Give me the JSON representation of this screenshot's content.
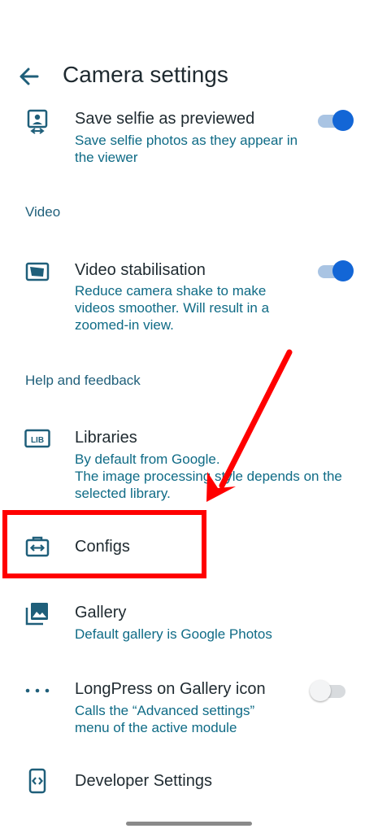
{
  "appbar": {
    "title": "Camera settings"
  },
  "items": {
    "selfie": {
      "title": "Save selfie as previewed",
      "subtitle": "Save selfie photos as they appear in the viewer",
      "icon": "selfie-icon",
      "toggle": true
    },
    "video_section": "Video",
    "stabilisation": {
      "title": "Video stabilisation",
      "subtitle": "Reduce camera shake to make videos smoother. Will result in a zoomed-in view.",
      "icon": "video-stabilisation-icon",
      "toggle": true
    },
    "help_section": "Help and feedback",
    "libraries": {
      "title": "Libraries",
      "subtitle_line1": "By default from Google.",
      "subtitle_line2": "The image processing style depends on the selected library.",
      "icon": "lib-icon",
      "icon_text": "LIB"
    },
    "configs": {
      "title": "Configs",
      "icon": "configs-icon"
    },
    "gallery": {
      "title": "Gallery",
      "subtitle": "Default gallery is Google Photos",
      "icon": "gallery-icon"
    },
    "longpress": {
      "title": "LongPress on Gallery icon",
      "subtitle": "Calls the “Advanced settings” menu of the active module",
      "icon": "more-dots-icon",
      "toggle": false
    },
    "developer": {
      "title": "Developer Settings",
      "icon": "developer-icon"
    }
  },
  "colors": {
    "accent": "#1366d6",
    "subtitle": "#0f6b86",
    "icon": "#1f5f7a",
    "annotation": "#ff0000"
  }
}
